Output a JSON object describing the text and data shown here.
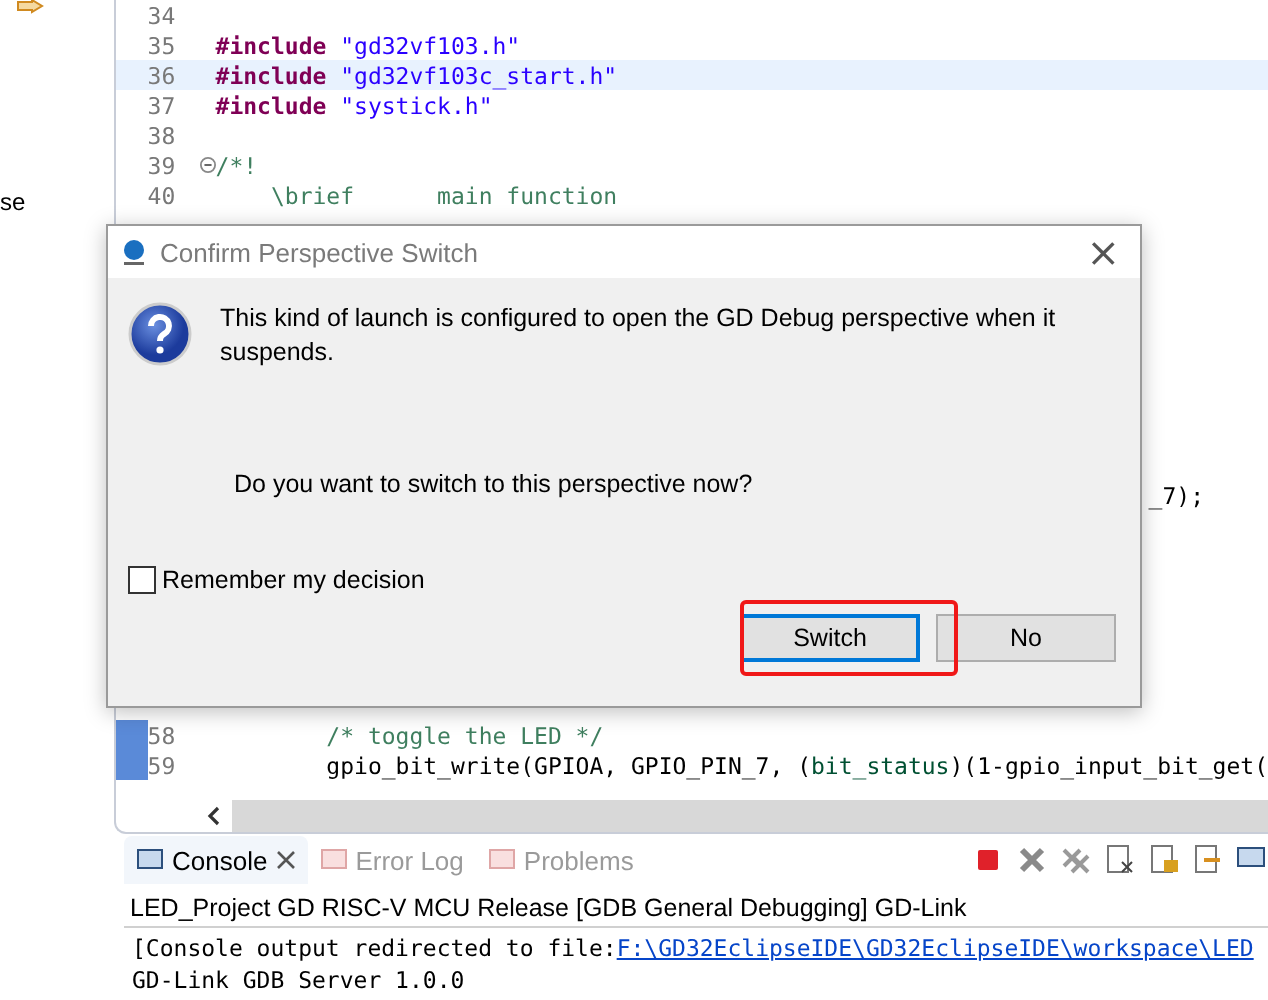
{
  "side_panel": {
    "label": "se"
  },
  "editor": {
    "lines_above": [
      {
        "number": "34",
        "current": false,
        "foldable": false
      },
      {
        "number": "35",
        "current": false,
        "foldable": false,
        "tokens": [
          {
            "kind": "directive",
            "text": "#include"
          },
          {
            "kind": "string",
            "text": " \"gd32vf103.h\""
          }
        ]
      },
      {
        "number": "36",
        "current": true,
        "foldable": false,
        "tokens": [
          {
            "kind": "directive",
            "text": "#include"
          },
          {
            "kind": "string",
            "text": " \"gd32vf103c_start.h\""
          }
        ]
      },
      {
        "number": "37",
        "current": false,
        "foldable": false,
        "tokens": [
          {
            "kind": "directive",
            "text": "#include"
          },
          {
            "kind": "string",
            "text": " \"systick.h\""
          }
        ]
      },
      {
        "number": "38",
        "current": false,
        "foldable": false
      },
      {
        "number": "39",
        "current": false,
        "foldable": true,
        "tokens": [
          {
            "kind": "comment",
            "text": "/*!"
          }
        ]
      },
      {
        "number": "40",
        "current": false,
        "foldable": false,
        "tokens": [
          {
            "kind": "comment",
            "text": "    \\brief      main function"
          }
        ]
      }
    ],
    "partial_line": {
      "text": "_7);"
    },
    "lines_below": [
      {
        "number": "58",
        "current": false,
        "foldable": false,
        "tokens": [
          {
            "kind": "comment",
            "text": "        /* toggle the LED */"
          }
        ]
      },
      {
        "number": "59",
        "current": false,
        "foldable": false,
        "tokens": [
          {
            "kind": "plain",
            "text": "        gpio_bit_write(GPIOA, GPIO_PIN_7, ("
          },
          {
            "kind": "type",
            "text": "bit_status"
          },
          {
            "kind": "plain",
            "text": ")(1-gpio_input_bit_get("
          }
        ]
      }
    ]
  },
  "dialog": {
    "title": "Confirm Perspective Switch",
    "close": "×",
    "message": "This kind of launch is configured to open the GD Debug perspective when it suspends.",
    "question": "Do you want to switch to this perspective now?",
    "remember": {
      "label": "Remember my decision",
      "checked": false
    },
    "buttons": [
      {
        "label": "Switch",
        "selected": true
      },
      {
        "label": "No",
        "selected": false
      }
    ]
  },
  "console": {
    "tabs": [
      {
        "label": "Console",
        "selected": true,
        "closable": true
      },
      {
        "label": "Error Log",
        "selected": false,
        "closable": false
      },
      {
        "label": "Problems",
        "selected": false,
        "closable": false
      }
    ],
    "heading": "LED_Project GD RISC-V MCU Release [GDB General Debugging] GD-Link",
    "output": [
      {
        "kind": "link",
        "text": "[Console output redirected to file:",
        "link": "F:\\GD32EclipseIDE\\GD32EclipseIDE\\workspace\\LED"
      },
      {
        "kind": "plain",
        "text": "GD-Link GDB Server 1.0.0"
      }
    ]
  }
}
